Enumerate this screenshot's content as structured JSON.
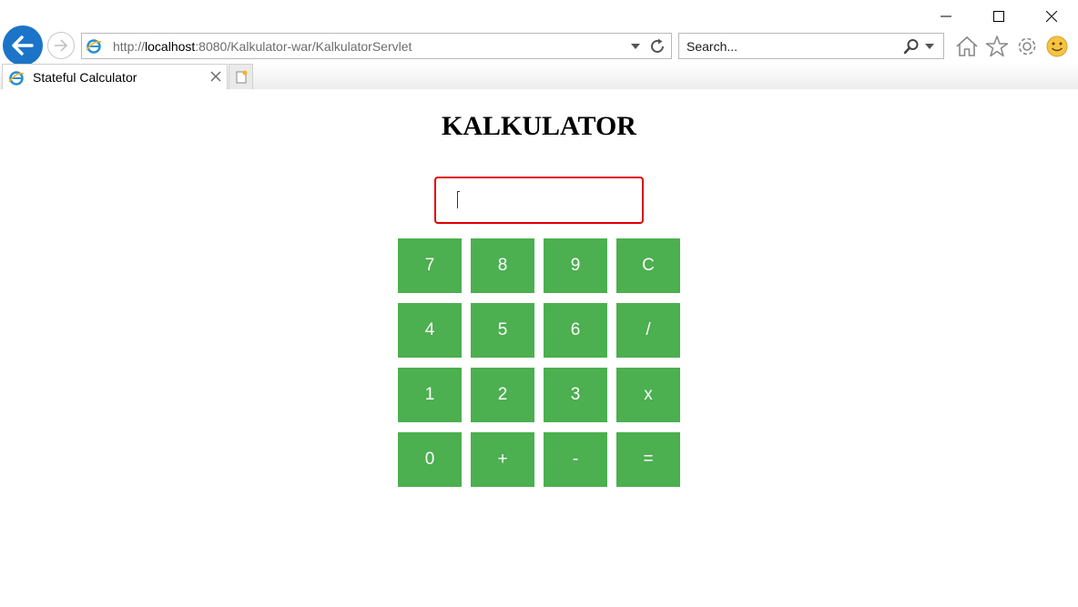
{
  "browser": {
    "address": {
      "prefix": "http://",
      "host": "localhost",
      "rest": ":8080/Kalkulator-war/KalkulatorServlet"
    },
    "search": {
      "placeholder": "Search..."
    },
    "tab": {
      "title": "Stateful Calculator"
    },
    "colors": {
      "back_button": "#1b74c8",
      "smiley": "#f6c343"
    }
  },
  "page": {
    "title": "KALKULATOR",
    "display": {
      "value": ""
    },
    "keys": [
      {
        "label": "7"
      },
      {
        "label": "8"
      },
      {
        "label": "9"
      },
      {
        "label": "C"
      },
      {
        "label": "4"
      },
      {
        "label": "5"
      },
      {
        "label": "6"
      },
      {
        "label": "/"
      },
      {
        "label": "1"
      },
      {
        "label": "2"
      },
      {
        "label": "3"
      },
      {
        "label": "x"
      },
      {
        "label": "0"
      },
      {
        "label": "+"
      },
      {
        "label": "-"
      },
      {
        "label": "="
      }
    ],
    "colors": {
      "key_bg": "#4caf50",
      "display_border": "#e00000"
    }
  }
}
